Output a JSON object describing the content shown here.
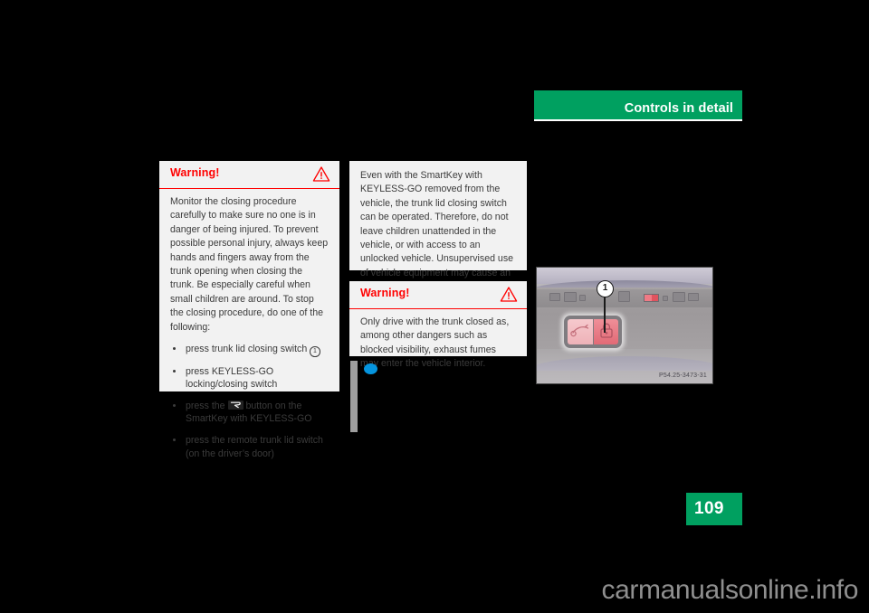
{
  "header": {
    "title": "Controls in detail",
    "bar_color": "#00A060"
  },
  "page": {
    "number": "109",
    "number_box_color": "#00A060"
  },
  "warning_box_1": {
    "title": "Warning!",
    "icon": "warning-triangle-icon",
    "accent_color": "#FF0000",
    "body": "Monitor the closing procedure carefully to make sure no one is in danger of being injured. To prevent possible personal injury, always keep hands and fingers away from the trunk opening when closing the trunk. Be especially careful when small children are around. To stop the closing procedure, do one of the following:",
    "bullets": [
      {
        "text_before": "press trunk lid closing switch",
        "marker": "1",
        "marker_type": "circled-number",
        "text_after": ""
      },
      {
        "text_before": "press KEYLESS-GO locking/closing switch",
        "marker": "",
        "marker_type": "none",
        "text_after": ""
      },
      {
        "text_before": "press the",
        "marker": "trunk-release-button-icon",
        "marker_type": "inline-key-button",
        "text_after": "button on the SmartKey with KEYLESS-GO"
      },
      {
        "text_before": "press the remote trunk lid switch (on the driver’s door)",
        "marker": "",
        "marker_type": "none",
        "text_after": ""
      }
    ]
  },
  "info_box": {
    "body": "Even with the SmartKey with KEYLESS-GO removed from the vehicle, the trunk lid closing switch can be operated. Therefore, do not leave children unattended in the vehicle, or with access to an unlocked vehicle. Unsupervised use of vehicle equipment may cause an accident and/or serious personal injury."
  },
  "warning_box_2": {
    "title": "Warning!",
    "icon": "warning-triangle-icon",
    "accent_color": "#FF0000",
    "body": "Only drive with the trunk closed as, among other dangers such as blocked visibility, exhaust fumes may enter the vehicle interior."
  },
  "markers": {
    "blue_dot_color": "#0594DE",
    "gray_rule_color": "#9E9E9E"
  },
  "figure": {
    "callout": "1",
    "code": "P54.25-3473-31",
    "left_button_icon": "trunk-open-icon",
    "right_button_icon": "lock-closed-icon"
  },
  "watermark": {
    "text": "carmanualsonline.info"
  }
}
